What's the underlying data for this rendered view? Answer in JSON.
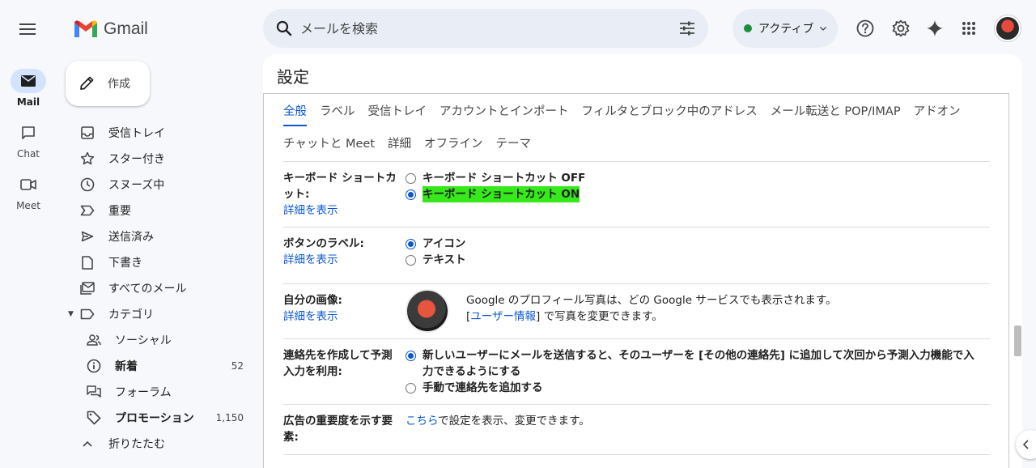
{
  "app": {
    "name": "Gmail"
  },
  "rail": {
    "items": [
      {
        "label": "Mail",
        "icon": "mail-icon",
        "active": true
      },
      {
        "label": "Chat",
        "icon": "chat-icon",
        "active": false
      },
      {
        "label": "Meet",
        "icon": "meet-icon",
        "active": false
      }
    ]
  },
  "search": {
    "placeholder": "メールを検索"
  },
  "status": {
    "label": "アクティブ",
    "color": "#1e8e3e"
  },
  "compose": {
    "label": "作成"
  },
  "nav": {
    "items": [
      {
        "label": "受信トレイ",
        "icon": "inbox-icon"
      },
      {
        "label": "スター付き",
        "icon": "star-icon"
      },
      {
        "label": "スヌーズ中",
        "icon": "clock-icon"
      },
      {
        "label": "重要",
        "icon": "important-icon"
      },
      {
        "label": "送信済み",
        "icon": "send-icon"
      },
      {
        "label": "下書き",
        "icon": "draft-icon"
      },
      {
        "label": "すべてのメール",
        "icon": "all-mail-icon"
      },
      {
        "label": "カテゴリ",
        "icon": "label-icon"
      },
      {
        "label": "ソーシャル",
        "icon": "social-icon"
      },
      {
        "label": "新着",
        "icon": "info-icon",
        "count": "52"
      },
      {
        "label": "フォーラム",
        "icon": "forum-icon"
      },
      {
        "label": "プロモーション",
        "icon": "tag-icon",
        "count": "1,150"
      },
      {
        "label": "折りたたむ",
        "icon": "chevron-up-icon"
      }
    ]
  },
  "settings": {
    "title": "設定",
    "tabs_row1": [
      "全般",
      "ラベル",
      "受信トレイ",
      "アカウントとインポート",
      "フィルタとブロック中のアドレス",
      "メール転送と POP/IMAP",
      "アドオン"
    ],
    "tabs_row2": [
      "チャットと Meet",
      "詳細",
      "オフライン",
      "テーマ"
    ],
    "active_tab": "全般",
    "keyboard": {
      "label": "キーボード ショートカット:",
      "link": "詳細を表示",
      "off": "キーボード ショートカット OFF",
      "on": "キーボード ショートカット ON"
    },
    "button_labels": {
      "label": "ボタンのラベル:",
      "link": "詳細を表示",
      "icon": "アイコン",
      "text": "テキスト"
    },
    "picture": {
      "label": "自分の画像:",
      "link": "詳細を表示",
      "line1": "Google のプロフィール写真は、どの Google サービスでも表示されます。",
      "line2_pre": "[",
      "line2_link": "ユーザー情報",
      "line2_post": "] で写真を変更できます。"
    },
    "contacts": {
      "label": "連絡先を作成して予測入力を利用:",
      "opt1": "新しいユーザーにメールを送信すると、そのユーザーを [その他の連絡先] に追加して次回から予測入力機能で入力できるようにする",
      "opt2": "手動で連絡先を追加する"
    },
    "ads": {
      "label": "広告の重要度を示す要素:",
      "link": "こちら",
      "text": "で設定を表示、変更できます。"
    }
  },
  "colors": {
    "accent": "#0b57d0",
    "highlight": "#36e81c"
  }
}
